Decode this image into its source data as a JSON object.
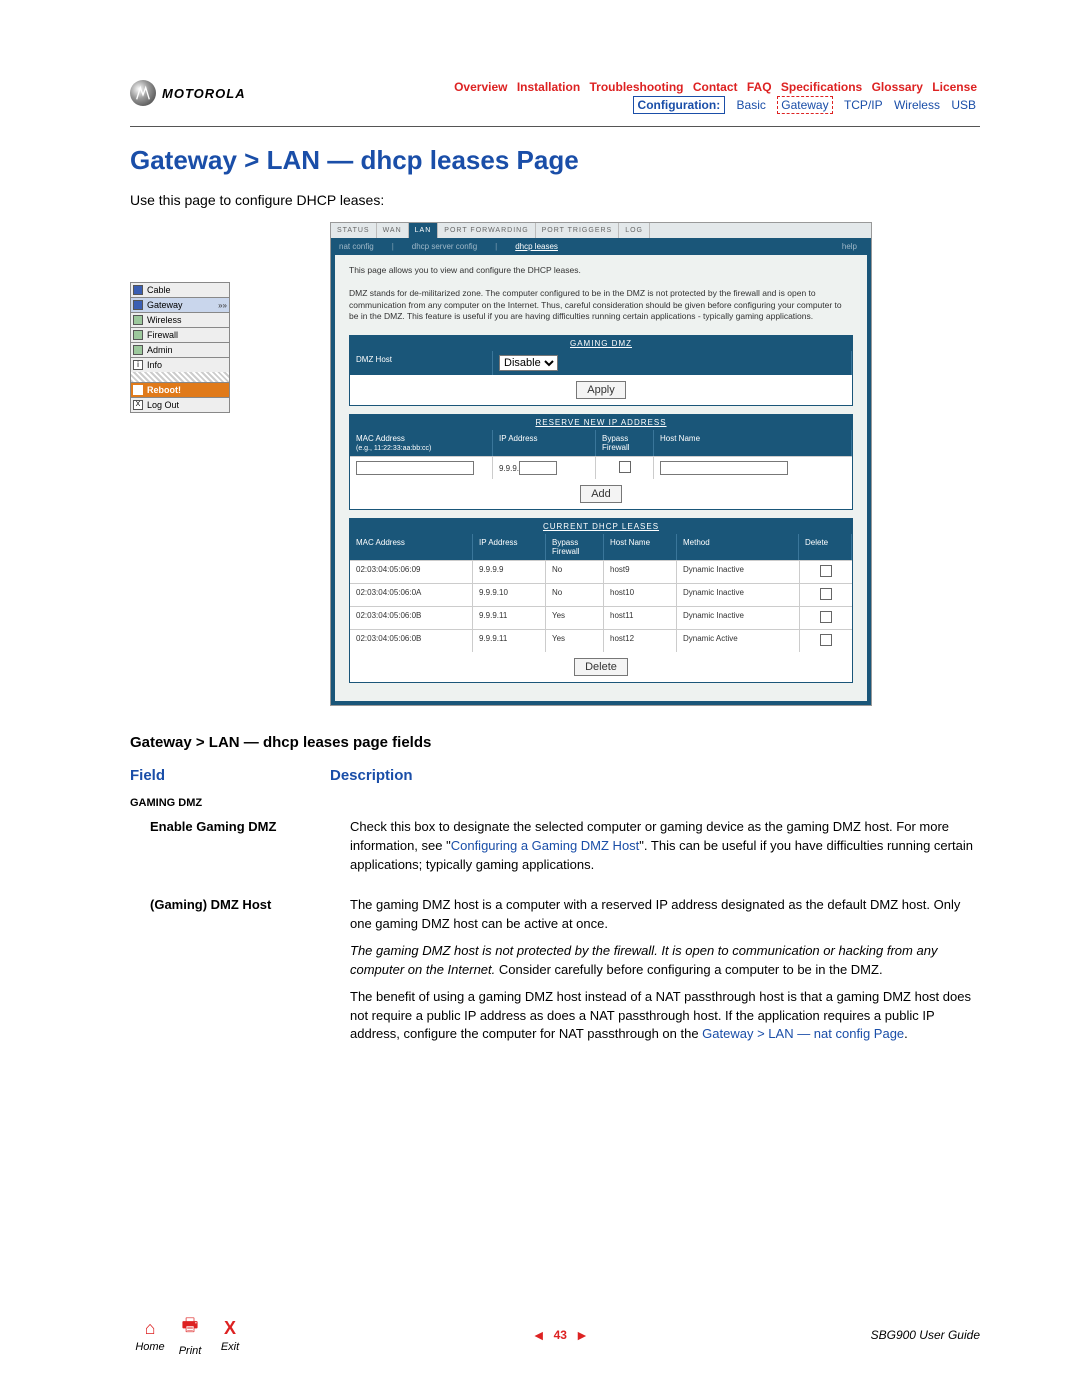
{
  "brand": {
    "name": "MOTOROLA"
  },
  "topnav": {
    "row1": [
      "Overview",
      "Installation",
      "Troubleshooting",
      "Contact",
      "FAQ",
      "Specifications",
      "Glossary",
      "License"
    ],
    "row2_label": "Configuration:",
    "row2": [
      "Basic",
      "Gateway",
      "TCP/IP",
      "Wireless",
      "USB"
    ],
    "row2_active": "Gateway"
  },
  "page": {
    "title": "Gateway > LAN — dhcp leases Page",
    "intro": "Use this page to configure DHCP leases:"
  },
  "leftnav": {
    "items": [
      "Cable",
      "Gateway",
      "Wireless",
      "Firewall",
      "Admin",
      "Info"
    ],
    "reboot": "Reboot!",
    "logout": "Log Out"
  },
  "ss": {
    "tabs": [
      "STATUS",
      "WAN",
      "LAN",
      "PORT FORWARDING",
      "PORT TRIGGERS",
      "LOG"
    ],
    "tabs_active": "LAN",
    "subtabs": [
      "nat config",
      "dhcp server config",
      "dhcp leases"
    ],
    "subtabs_active": "dhcp leases",
    "help": "help",
    "desc1": "This page allows you to view and configure the DHCP leases.",
    "desc2": "DMZ stands for de-militarized zone. The computer configured to be in the DMZ is not protected by the firewall and is open to communication from any computer on the Internet. Thus, careful consideration should be given before configuring your computer to be in the DMZ. This feature is useful if you are having difficulties running certain applications - typically gaming applications.",
    "panel1": {
      "title": "GAMING DMZ",
      "label": "DMZ Host",
      "options": [
        "Disable"
      ],
      "apply": "Apply"
    },
    "panel2": {
      "title": "RESERVE NEW IP ADDRESS",
      "headers": {
        "mac": "MAC Address",
        "mac_hint": "(e.g., 11:22:33:aa:bb:cc)",
        "ip": "IP Address",
        "bypass": "Bypass Firewall",
        "host": "Host Name"
      },
      "ip_prefix": "9.9.9.",
      "add": "Add"
    },
    "panel3": {
      "title": "CURRENT DHCP LEASES",
      "headers": {
        "mac": "MAC Address",
        "ip": "IP Address",
        "bypass": "Bypass Firewall",
        "host": "Host Name",
        "method": "Method",
        "del": "Delete"
      },
      "rows": [
        {
          "mac": "02:03:04:05:06:09",
          "ip": "9.9.9.9",
          "bypass": "No",
          "host": "host9",
          "method": "Dynamic Inactive"
        },
        {
          "mac": "02:03:04:05:06:0A",
          "ip": "9.9.9.10",
          "bypass": "No",
          "host": "host10",
          "method": "Dynamic Inactive"
        },
        {
          "mac": "02:03:04:05:06:0B",
          "ip": "9.9.9.11",
          "bypass": "Yes",
          "host": "host11",
          "method": "Dynamic Inactive"
        },
        {
          "mac": "02:03:04:05:06:0B",
          "ip": "9.9.9.11",
          "bypass": "Yes",
          "host": "host12",
          "method": "Dynamic Active"
        }
      ],
      "delete": "Delete"
    }
  },
  "fields": {
    "section": "Gateway > LAN — dhcp leases page fields",
    "h1": "Field",
    "h2": "Description",
    "group1": "GAMING DMZ",
    "rows": [
      {
        "label": "Enable Gaming DMZ",
        "text1": "Check this box to designate the selected computer or gaming device as the gaming DMZ host. For more information, see \"",
        "link1": "Configuring a Gaming DMZ Host",
        "text1b": "\". This can be useful if you have difficulties running certain applications; typically gaming applications."
      },
      {
        "label": "(Gaming) DMZ Host",
        "text1": "The gaming DMZ host is a computer with a reserved IP address designated as the default DMZ host. Only one gaming DMZ host can be active at once.",
        "em": "The gaming DMZ host is not protected by the firewall. It is open to communication or hacking from any computer on the Internet.",
        "text2": " Consider carefully before configuring a computer to be in the DMZ.",
        "text3": "The benefit of using a gaming DMZ host instead of a NAT passthrough host is that a gaming DMZ host does not require a public IP address as does a NAT passthrough host. If the application requires a public IP address, configure the computer for NAT passthrough on the ",
        "link2": "Gateway > LAN — nat config Page",
        "text3b": "."
      }
    ]
  },
  "footer": {
    "home": "Home",
    "print": "Print",
    "exit": "Exit",
    "page": "43",
    "guide": "SBG900 User Guide"
  }
}
